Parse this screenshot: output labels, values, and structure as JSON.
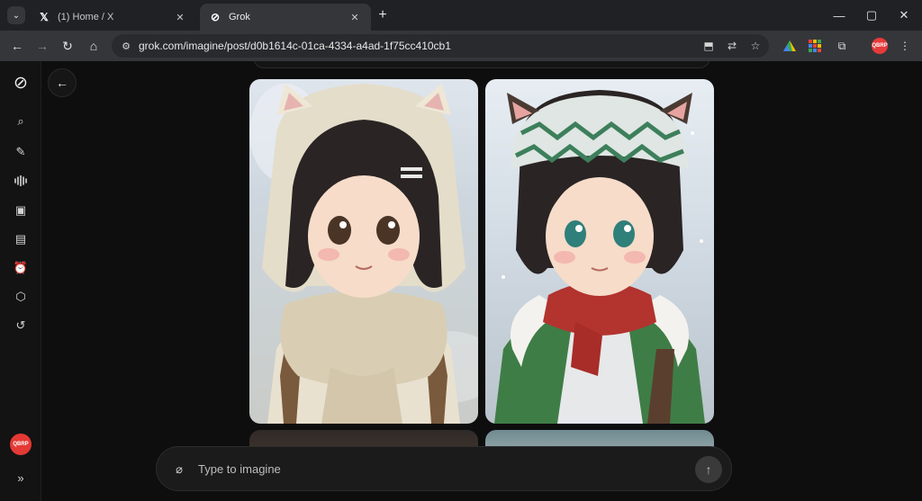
{
  "browser": {
    "tabs": [
      {
        "title": "(1) Home / X",
        "icon": "x-logo-icon",
        "active": false
      },
      {
        "title": "Grok",
        "icon": "grok-logo-icon",
        "active": true
      }
    ],
    "url": "grok.com/imagine/post/d0b1614c-01ca-4334-a4ad-1f75cc410cb1",
    "profile_badge": "QBRP"
  },
  "sidebar": {
    "items": [
      {
        "name": "search",
        "icon": "search-icon"
      },
      {
        "name": "new-chat",
        "icon": "edit-icon"
      },
      {
        "name": "voice",
        "icon": "waveform-icon"
      },
      {
        "name": "imagine",
        "icon": "image-icon"
      },
      {
        "name": "notes",
        "icon": "note-icon"
      },
      {
        "name": "tasks",
        "icon": "alarm-icon"
      },
      {
        "name": "projects",
        "icon": "cube-icon"
      },
      {
        "name": "history",
        "icon": "history-icon"
      }
    ],
    "avatar_label": "QBRP",
    "expand_icon": "chevrons-right-icon"
  },
  "composer": {
    "placeholder": "Type to imagine"
  },
  "colors": {
    "background": "#0e0e0e",
    "sidebar": "#131313",
    "avatar": "#e53935"
  }
}
